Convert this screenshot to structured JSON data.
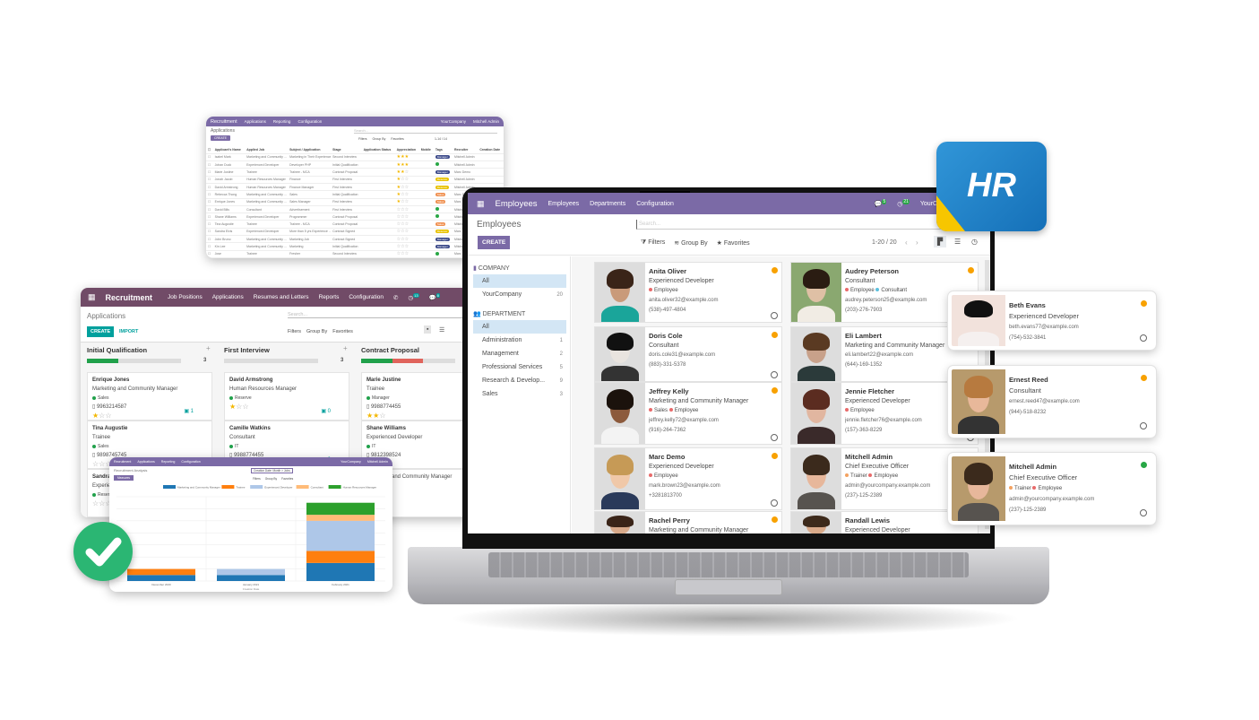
{
  "list_window": {
    "app": "Recruitment",
    "menu": [
      "Applications",
      "Reporting",
      "Configuration"
    ],
    "title": "Applications",
    "create_label": "CREATE",
    "search_placeholder": "Search...",
    "filters": "Filters",
    "group_by": "Group By",
    "favorites": "Favorites",
    "pager": "1-14 / 14",
    "company": "YourCompany",
    "user": "Mitchell Admin",
    "columns": [
      "Applicant's Name",
      "Applied Job",
      "Subject / Application",
      "Stage",
      "Application Status",
      "Appreciation",
      "Mobile",
      "Tags",
      "Recruiter",
      "Creation Date"
    ],
    "rows": [
      {
        "name": "Isabel Mark",
        "job": "Marketing and Community ...",
        "subject": "Marketing in Their Experience",
        "stage": "Second Interview",
        "stars": 3,
        "tag": "Manager",
        "recruiter": "Mitchell Admin"
      },
      {
        "name": "Johan Duck",
        "job": "Experienced Developer",
        "subject": "Developer PHP",
        "stage": "Initial Qualification",
        "stars": 3,
        "tag": "",
        "recruiter": "Mitchell Admin"
      },
      {
        "name": "Marie Justine",
        "job": "Trainee",
        "subject": "Trainee - MCA",
        "stage": "Contract Proposal",
        "stars": 2,
        "tag": "Manager",
        "recruiter": "Marc Demo"
      },
      {
        "name": "Jonah Jacob",
        "job": "Human Resources Manager",
        "subject": "Finance",
        "stage": "First Interview",
        "stars": 1,
        "tag": "Reserve",
        "recruiter": "Mitchell Admin"
      },
      {
        "name": "David Armstrong",
        "job": "Human Resources Manager",
        "subject": "Finance Manager",
        "stage": "First Interview",
        "stars": 1,
        "tag": "Reserve",
        "recruiter": "Mitchell Admin"
      },
      {
        "name": "Rebecca Thong",
        "job": "Marketing and Community ...",
        "subject": "Sales",
        "stage": "Initial Qualification",
        "stars": 1,
        "tag": "Sales",
        "recruiter": "Marc Demo"
      },
      {
        "name": "Enrique Jones",
        "job": "Marketing and Community ...",
        "subject": "Sales Manager",
        "stage": "First Interview",
        "stars": 1,
        "tag": "Sales",
        "recruiter": "Marc Demo"
      },
      {
        "name": "David Bills",
        "job": "Consultant",
        "subject": "Advertisement",
        "stage": "First Interview",
        "stars": 0,
        "tag": "",
        "recruiter": "Mitchell Admin"
      },
      {
        "name": "Shane Williams",
        "job": "Experienced Developer",
        "subject": "Programmer",
        "stage": "Contract Proposal",
        "stars": 0,
        "tag": "",
        "recruiter": "Mitchell Admin"
      },
      {
        "name": "Tina Augustie",
        "job": "Trainee",
        "subject": "Trainee - MCA",
        "stage": "Contract Proposal",
        "stars": 0,
        "tag": "Sales",
        "recruiter": "Mitchell Admin"
      },
      {
        "name": "Sandra Elvis",
        "job": "Experienced Developer",
        "subject": "More than 5 yrs Experience ...",
        "stage": "Contract Signed",
        "stars": 0,
        "tag": "Reserve",
        "recruiter": "Marc Demo"
      },
      {
        "name": "John Bruno",
        "job": "Marketing and Community ...",
        "subject": "Marketing Job",
        "stage": "Contract Signed",
        "stars": 0,
        "tag": "Manager",
        "recruiter": "Mitchell Admin"
      },
      {
        "name": "Kin Lee",
        "job": "Marketing and Community ...",
        "subject": "Marketing",
        "stage": "Initial Qualification",
        "stars": 0,
        "tag": "Manager",
        "recruiter": "Mitchell Admin"
      },
      {
        "name": "Jose",
        "job": "Trainee",
        "subject": "Fresher",
        "stage": "Second Interview",
        "stars": 0,
        "tag": "",
        "recruiter": "Marc Demo"
      }
    ]
  },
  "kanban_window": {
    "app": "Recruitment",
    "menu": [
      "Job Positions",
      "Applications",
      "Resumes and Letters",
      "Reports",
      "Configuration"
    ],
    "badges": {
      "activities": "13",
      "messages": "8"
    },
    "title": "Applications",
    "search_placeholder": "Search...",
    "create_label": "CREATE",
    "import_label": "IMPORT",
    "filters": "Filters",
    "group_by": "Group By",
    "favorites": "Favorites",
    "columns": [
      {
        "title": "Initial Qualification",
        "count": "3",
        "progress": {
          "green": 0.33,
          "red": 0
        },
        "cards": [
          {
            "name": "Enrique Jones",
            "job": "Marketing and Community Manager",
            "tag": "Sales",
            "phone": "9963214587",
            "stars": 1,
            "attachments": "1"
          },
          {
            "name": "Tina Augustie",
            "job": "Trainee",
            "tag": "Sales",
            "phone": "9898745745",
            "stars": 0,
            "attachments": ""
          },
          {
            "name": "Sandra",
            "job": "Experienced Developer",
            "tag": "Reserve",
            "phone": "",
            "stars": 0,
            "attachments": ""
          }
        ]
      },
      {
        "title": "First Interview",
        "count": "3",
        "progress": {
          "green": 0,
          "red": 0
        },
        "cards": [
          {
            "name": "David Armstrong",
            "job": "Human Resources Manager",
            "tag": "Reserve",
            "phone": "",
            "stars": 1,
            "attachments": "0"
          },
          {
            "name": "Camille Watkins",
            "job": "Consultant",
            "tag": "IT",
            "phone": "9988774455",
            "stars": 0,
            "attachments": "0"
          }
        ]
      },
      {
        "title": "Contract Proposal",
        "count": "",
        "progress": {
          "green": 0.33,
          "red": 0.33
        },
        "cards": [
          {
            "name": "Marie Justine",
            "job": "Trainee",
            "tag": "Manager",
            "phone": "9988774455",
            "stars": 2,
            "attachments": ""
          },
          {
            "name": "Shane Williams",
            "job": "Experienced Developer",
            "tag": "IT",
            "phone": "9812398524",
            "stars": 0,
            "attachments": ""
          },
          {
            "name": "",
            "job": "Marketing and Community Manager",
            "tag": "",
            "phone": "",
            "stars": 0,
            "attachments": ""
          }
        ]
      }
    ]
  },
  "chart_window": {
    "app": "Recruitment",
    "menu": [
      "Applications",
      "Reporting",
      "Configuration"
    ],
    "title": "Recruitment Analysis",
    "measures_label": "Measures",
    "filter_facet": "Creation Date: Month > Jobs",
    "filters": "Filters",
    "group_by": "Group By",
    "favorites": "Favorites",
    "company": "YourCompany",
    "user": "Mitchell Admin"
  },
  "chart_data": {
    "type": "bar",
    "stacked": true,
    "categories": [
      "December 2020",
      "January 2021",
      "February 2021"
    ],
    "xlabel": "Creation Date",
    "ylim": [
      0,
      14
    ],
    "grid": true,
    "legend": "top",
    "series": [
      {
        "name": "Marketing and Community Manager",
        "color": "#1f77b4",
        "values": [
          1,
          1,
          3
        ]
      },
      {
        "name": "Trainee",
        "color": "#ff7f0e",
        "values": [
          1,
          0,
          2
        ]
      },
      {
        "name": "Experienced Developer",
        "color": "#aec7e8",
        "values": [
          0,
          1,
          5
        ]
      },
      {
        "name": "Consultant",
        "color": "#ffbb78",
        "values": [
          0,
          0,
          1
        ]
      },
      {
        "name": "Human Resources Manager",
        "color": "#2ca02c",
        "values": [
          0,
          0,
          2
        ]
      }
    ]
  },
  "employees_app": {
    "app": "Employees",
    "menu": [
      "Employees",
      "Departments",
      "Configuration"
    ],
    "badges": {
      "messages": "5",
      "activities": "21"
    },
    "company": "YourCompany",
    "title": "Employees",
    "search_placeholder": "Search...",
    "create_label": "CREATE",
    "filters": "Filters",
    "group_by": "Group By",
    "favorites": "Favorites",
    "pager": "1-20 / 20",
    "sidebar": {
      "company_header": "COMPANY",
      "company_items": [
        {
          "label": "All",
          "count": ""
        },
        {
          "label": "YourCompany",
          "count": "20"
        }
      ],
      "department_header": "DEPARTMENT",
      "department_items": [
        {
          "label": "All",
          "count": ""
        },
        {
          "label": "Administration",
          "count": "1"
        },
        {
          "label": "Management",
          "count": "2"
        },
        {
          "label": "Professional Services",
          "count": "5"
        },
        {
          "label": "Research & Develop...",
          "count": "9"
        },
        {
          "label": "Sales",
          "count": "3"
        }
      ]
    },
    "employees": [
      {
        "name": "Anita Oliver",
        "job": "Experienced Developer",
        "tags": [
          "Employee"
        ],
        "email": "anita.oliver32@example.com",
        "phone": "(538)-497-4804",
        "status": "#f8a100"
      },
      {
        "name": "Audrey Peterson",
        "job": "Consultant",
        "tags": [
          "Employee",
          "Consultant"
        ],
        "email": "audrey.peterson25@example.com",
        "phone": "(203)-276-7903",
        "status": "#f8a100"
      },
      {
        "name": "Doris Cole",
        "job": "Consultant",
        "tags": [],
        "email": "doris.cole31@example.com",
        "phone": "(883)-331-5378",
        "status": "#f8a100"
      },
      {
        "name": "Eli Lambert",
        "job": "Marketing and Community Manager",
        "tags": [],
        "email": "eli.lambert22@example.com",
        "phone": "(644)-169-1352",
        "status": ""
      },
      {
        "name": "Jeffrey Kelly",
        "job": "Marketing and Community Manager",
        "tags": [
          "Sales",
          "Employee"
        ],
        "email": "jeffrey.kelly72@example.com",
        "phone": "(916)-264-7362",
        "status": "#f8a100"
      },
      {
        "name": "Jennie Fletcher",
        "job": "Experienced Developer",
        "tags": [
          "Employee"
        ],
        "email": "jennie.fletcher76@example.com",
        "phone": "(157)-363-8229",
        "status": ""
      },
      {
        "name": "Marc Demo",
        "job": "Experienced Developer",
        "tags": [
          "Employee"
        ],
        "email": "mark.brown23@example.com",
        "phone": "+3281813700",
        "status": "#f8a100"
      },
      {
        "name": "Mitchell Admin",
        "job": "Chief Executive Officer",
        "tags": [
          "Trainer",
          "Employee"
        ],
        "email": "admin@yourcompany.example.com",
        "phone": "(237)-125-2389",
        "status": ""
      },
      {
        "name": "Rachel Perry",
        "job": "Marketing and Community Manager",
        "tags": [],
        "email": "",
        "phone": "",
        "status": "#f8a100"
      },
      {
        "name": "Randall Lewis",
        "job": "Experienced Developer",
        "tags": [],
        "email": "",
        "phone": "",
        "status": ""
      }
    ]
  },
  "floating_cards": [
    {
      "name": "Beth Evans",
      "job": "Experienced Developer",
      "tags": [],
      "email": "beth.evans77@example.com",
      "phone": "(754)-532-3841",
      "status": "#f8a100"
    },
    {
      "name": "Ernest Reed",
      "job": "Consultant",
      "tags": [],
      "email": "ernest.reed47@example.com",
      "phone": "(944)-518-8232",
      "status": "#f8a100"
    },
    {
      "name": "Mitchell Admin",
      "job": "Chief Executive Officer",
      "tags": [
        "Trainer",
        "Employee"
      ],
      "email": "admin@yourcompany.example.com",
      "phone": "(237)-125-2389",
      "status": "#28a745"
    }
  ],
  "hr_badge": {
    "text": "HR",
    "color": "#1f7fc4",
    "accent": "#f7c600"
  },
  "colors": {
    "employees_nav": "#7b6aa6",
    "recruitment_nav": "#714b67",
    "teal": "#00a09d",
    "success": "#2bb673"
  }
}
